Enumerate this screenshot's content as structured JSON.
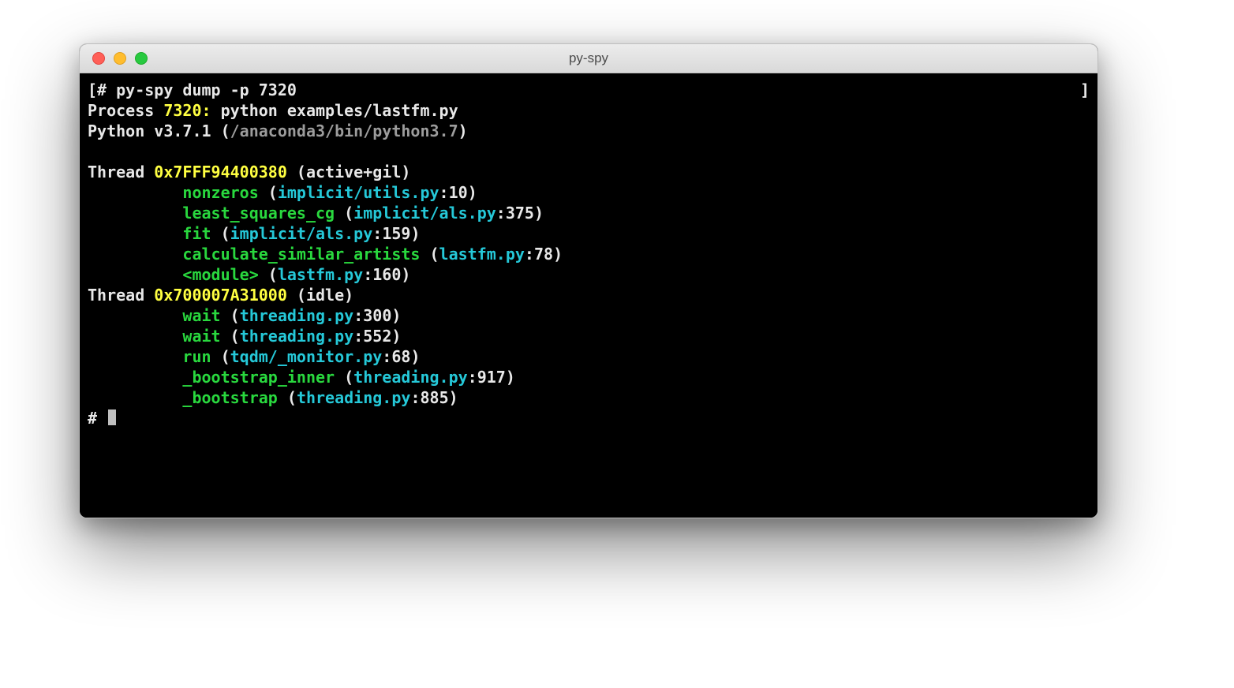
{
  "window": {
    "title": "py-spy"
  },
  "cmd": {
    "bracket_open": "[",
    "prompt": "#",
    "command": " py-spy dump -p 7320",
    "bracket_close": "]"
  },
  "process_line": {
    "label": "Process ",
    "pid": "7320",
    "colon": ":",
    "rest": " python examples/lastfm.py"
  },
  "python_line": {
    "prefix": "Python ",
    "version": "v3.7.1",
    "space_paren": " (",
    "path": "/anaconda3/bin/python3.7",
    "close": ")"
  },
  "threads": [
    {
      "label": "Thread ",
      "id": "0x7FFF94400380",
      "state": " (active+gil)",
      "frames": [
        {
          "func": "nonzeros",
          "file": "implicit/utils.py",
          "line": "10"
        },
        {
          "func": "least_squares_cg",
          "file": "implicit/als.py",
          "line": "375"
        },
        {
          "func": "fit",
          "file": "implicit/als.py",
          "line": "159"
        },
        {
          "func": "calculate_similar_artists",
          "file": "lastfm.py",
          "line": "78"
        },
        {
          "func": "<module>",
          "file": "lastfm.py",
          "line": "160"
        }
      ]
    },
    {
      "label": "Thread ",
      "id": "0x700007A31000",
      "state": " (idle)",
      "frames": [
        {
          "func": "wait",
          "file": "threading.py",
          "line": "300"
        },
        {
          "func": "wait",
          "file": "threading.py",
          "line": "552"
        },
        {
          "func": "run",
          "file": "tqdm/_monitor.py",
          "line": "68"
        },
        {
          "func": "_bootstrap_inner",
          "file": "threading.py",
          "line": "917"
        },
        {
          "func": "_bootstrap",
          "file": "threading.py",
          "line": "885"
        }
      ]
    }
  ],
  "final_prompt": "#"
}
